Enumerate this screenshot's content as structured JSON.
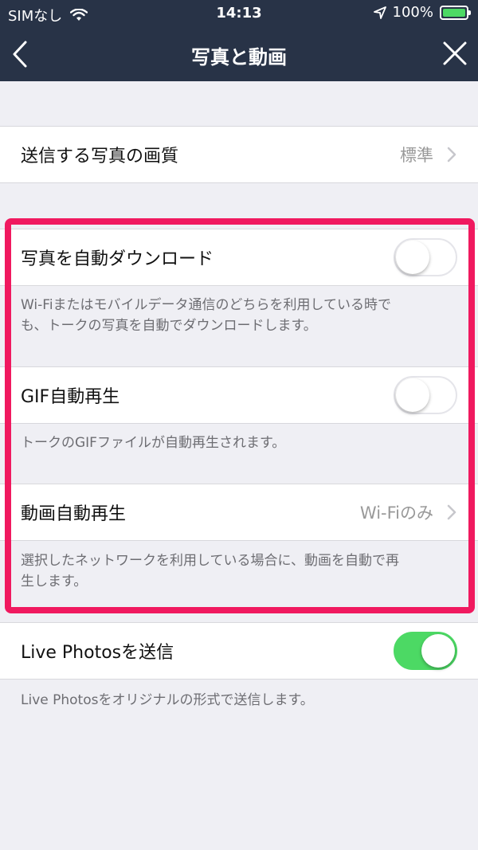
{
  "status_bar": {
    "carrier": "SIMなし",
    "time": "14:13",
    "battery": "100%",
    "battery_level": 1.0
  },
  "nav": {
    "title": "写真と動画",
    "back_icon": "chevron-left-icon",
    "close_icon": "close-icon"
  },
  "rows": {
    "photo_quality": {
      "label": "送信する写真の画質",
      "value": "標準"
    },
    "auto_download": {
      "label": "写真を自動ダウンロード",
      "on": false,
      "desc_line1": "Wi-Fiまたはモバイルデータ通信のどちらを利用している時で",
      "desc_line2": "も、トークの写真を自動でダウンロードします。"
    },
    "gif_autoplay": {
      "label": "GIF自動再生",
      "on": false,
      "desc": "トークのGIFファイルが自動再生されます。"
    },
    "video_autoplay": {
      "label": "動画自動再生",
      "value": "Wi-Fiのみ",
      "desc_line1": "選択したネットワークを利用している場合に、動画を自動で再",
      "desc_line2": "生します。"
    },
    "live_photos": {
      "label": "Live Photosを送信",
      "on": true,
      "desc": "Live Photosをオリジナルの形式で送信します。"
    }
  },
  "colors": {
    "header_bg": "#283347",
    "highlight": "#f0195f",
    "toggle_on": "#4cd964"
  }
}
